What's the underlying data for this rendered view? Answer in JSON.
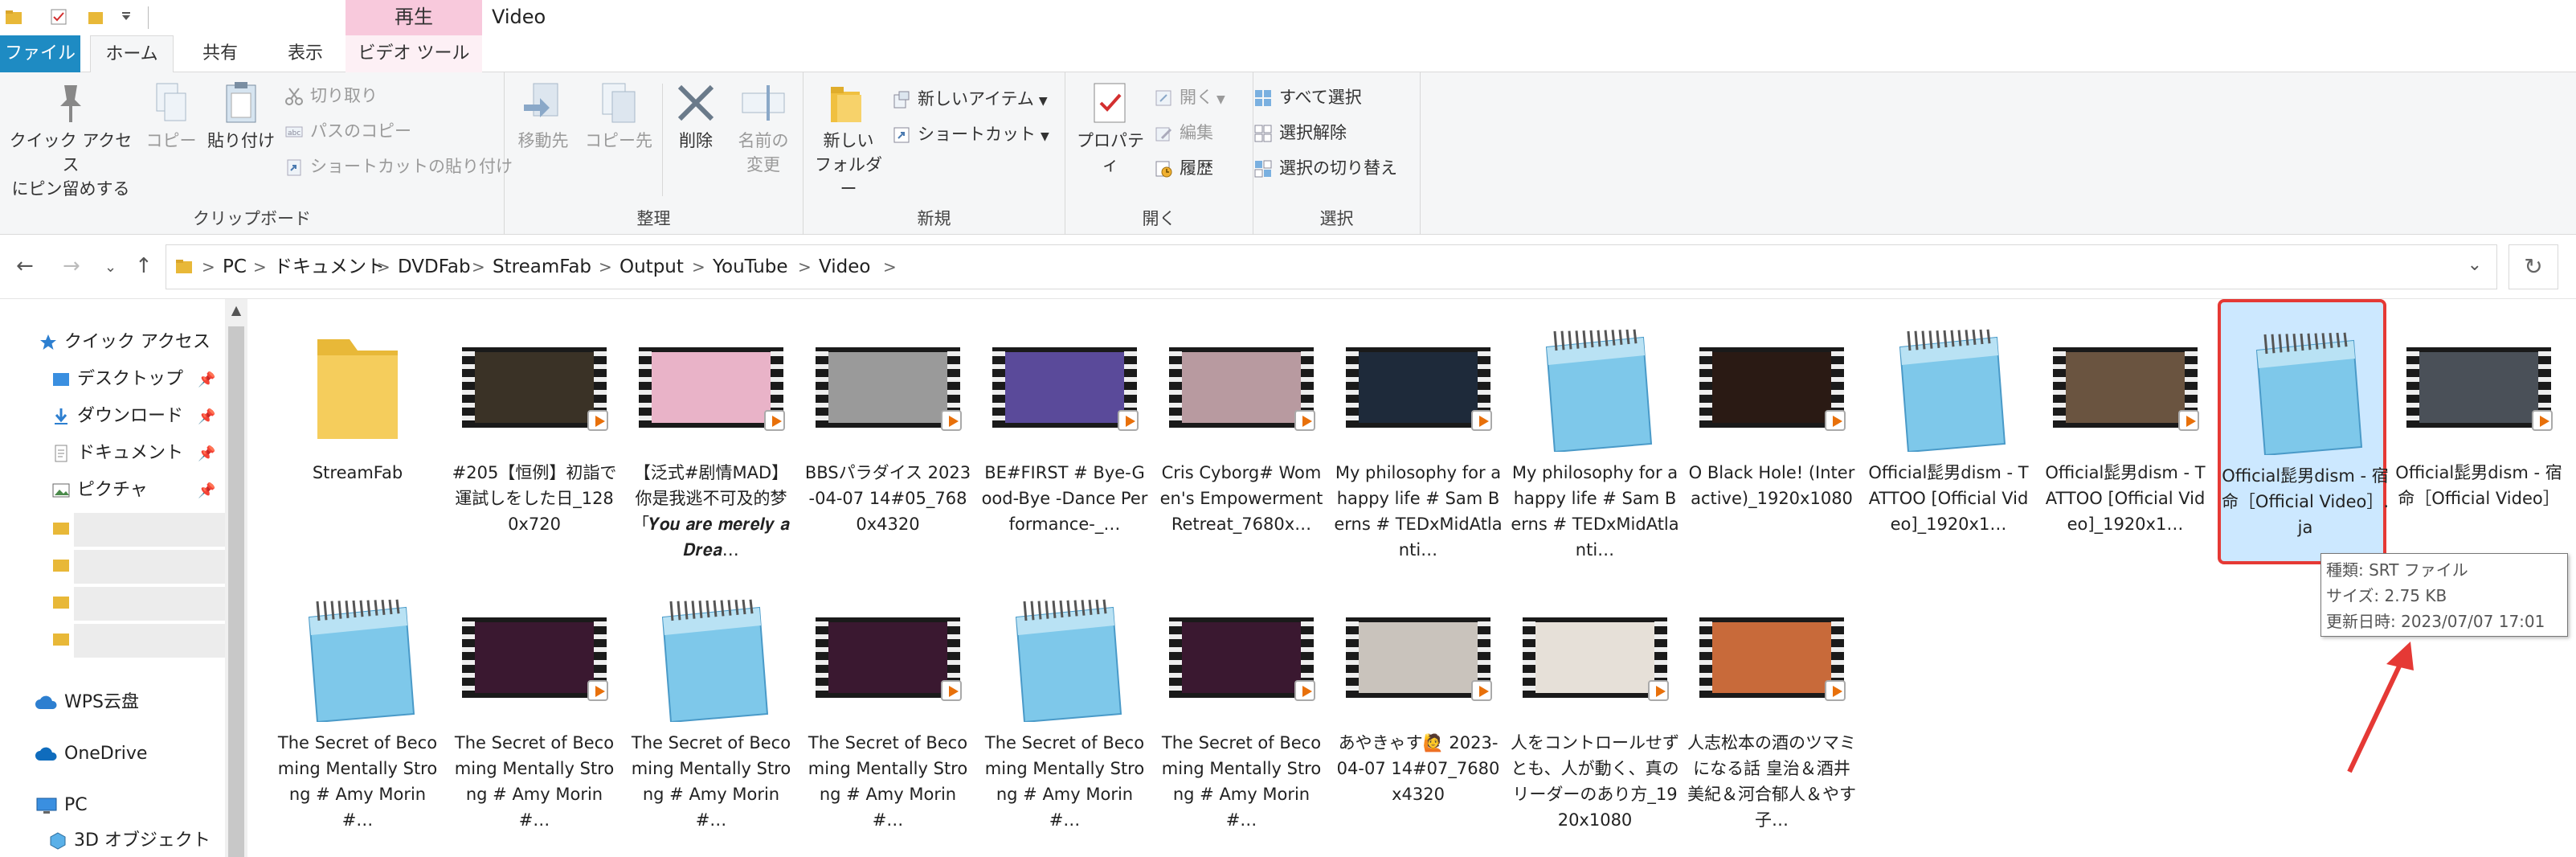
{
  "window": {
    "title": "Video",
    "contextual_tab": "再生"
  },
  "ribbon_tabs": {
    "file": "ファイル",
    "home": "ホーム",
    "share": "共有",
    "view": "表示",
    "video_tools": "ビデオ ツール"
  },
  "ribbon": {
    "clipboard": {
      "label": "クリップボード",
      "pin_line1": "クイック アクセス",
      "pin_line2": "にピン留めする",
      "copy": "コピー",
      "paste": "貼り付け",
      "cut": "切り取り",
      "copy_path": "パスのコピー",
      "paste_shortcut": "ショートカットの貼り付け"
    },
    "organize": {
      "label": "整理",
      "move_to": "移動先",
      "copy_to": "コピー先",
      "delete": "削除",
      "rename_line1": "名前の",
      "rename_line2": "変更"
    },
    "new": {
      "label": "新規",
      "new_folder_line1": "新しい",
      "new_folder_line2": "フォルダー",
      "new_item": "新しいアイテム",
      "shortcut": "ショートカット"
    },
    "open": {
      "label": "開く",
      "properties": "プロパティ",
      "open": "開く",
      "edit": "編集",
      "history": "履歴"
    },
    "select": {
      "label": "選択",
      "select_all": "すべて選択",
      "select_none": "選択解除",
      "invert": "選択の切り替え"
    }
  },
  "address": {
    "crumbs": [
      "PC",
      "ドキュメント",
      "DVDFab",
      "StreamFab",
      "Output",
      "YouTube",
      "Video"
    ]
  },
  "navpane": {
    "quick_access": "クイック アクセス",
    "desktop": "デスクトップ",
    "downloads": "ダウンロード",
    "documents": "ドキュメント",
    "pictures": "ピクチャ",
    "wps": "WPS云盘",
    "onedrive": "OneDrive",
    "pc": "PC",
    "objects3d": "3D オブジェクト"
  },
  "files": [
    {
      "name": "StreamFab",
      "kind": "folder"
    },
    {
      "name": "#205【恒例】初詣で運試しをした日_1280x720",
      "kind": "video",
      "color": "#3a3226"
    },
    {
      "name": "【泛式#剧情MAD】你是我逃不可及的梦「𝒀𝒐𝒖 𝒂𝒓𝒆 𝒎𝒆𝒓𝒆𝒍𝒚 𝒂 𝑫𝒓𝒆𝒂…",
      "kind": "video",
      "color": "#e9b3c8"
    },
    {
      "name": "BBSパラダイス 2023-04-07 14#05_7680x4320",
      "kind": "video",
      "color": "#9a9a9a"
    },
    {
      "name": "BE#FIRST # Bye-Good-Bye -Dance Performance-_…",
      "kind": "video",
      "color": "#5a4a9a"
    },
    {
      "name": "Cris Cyborg# Women's Empowerment Retreat_7680x…",
      "kind": "video",
      "color": "#b89aa0"
    },
    {
      "name": "My philosophy for a happy life # Sam Berns # TEDxMidAtlanti…",
      "kind": "video",
      "color": "#1e2a3a"
    },
    {
      "name": "My philosophy for a happy life # Sam Berns # TEDxMidAtlanti…",
      "kind": "notepad"
    },
    {
      "name": "O Black Hole! (Interactive)_1920x1080",
      "kind": "video",
      "color": "#2a1a14"
    },
    {
      "name": "Official髭男dism - TATTOO [Official Video]_1920x1…",
      "kind": "notepad"
    },
    {
      "name": "Official髭男dism - TATTOO [Official Video]_1920x1…",
      "kind": "video",
      "color": "#6a5440"
    },
    {
      "name": "Official髭男dism - 宿命［Official Video］.ja",
      "kind": "notepad",
      "selected": true
    },
    {
      "name": "Official髭男dism - 宿命［Official Video］",
      "kind": "video",
      "color": "#4a5058"
    },
    {
      "name": "The Secret of Becoming Mentally Strong # Amy Morin #…",
      "kind": "notepad"
    },
    {
      "name": "The Secret of Becoming Mentally Strong # Amy Morin #…",
      "kind": "video",
      "color": "#3a1830"
    },
    {
      "name": "The Secret of Becoming Mentally Strong # Amy Morin #…",
      "kind": "notepad"
    },
    {
      "name": "The Secret of Becoming Mentally Strong # Amy Morin #…",
      "kind": "video",
      "color": "#3a1830"
    },
    {
      "name": "The Secret of Becoming Mentally Strong # Amy Morin #…",
      "kind": "notepad"
    },
    {
      "name": "The Secret of Becoming Mentally Strong # Amy Morin #…",
      "kind": "video",
      "color": "#3a1830"
    },
    {
      "name": "あやきゃす🙋 2023-04-07 14#07_7680x4320",
      "kind": "video",
      "color": "#c9c3bc"
    },
    {
      "name": "人をコントロールせずとも、人が動く、真のリーダーのあり方_1920x1080",
      "kind": "video",
      "color": "#e6e0d8"
    },
    {
      "name": "人志松本の酒のツマミになる話 皇治＆酒井美紀＆河合郁人＆やす子…",
      "kind": "video",
      "color": "#c86a3a"
    }
  ],
  "tooltip": {
    "type_line": "種類: SRT ファイル",
    "size_line": "サイズ: 2.75 KB",
    "date_line": "更新日時: 2023/07/07 17:01"
  },
  "colors": {
    "accent": "#1e8bc3",
    "selection": "#cce8ff",
    "highlight": "#e53935"
  }
}
